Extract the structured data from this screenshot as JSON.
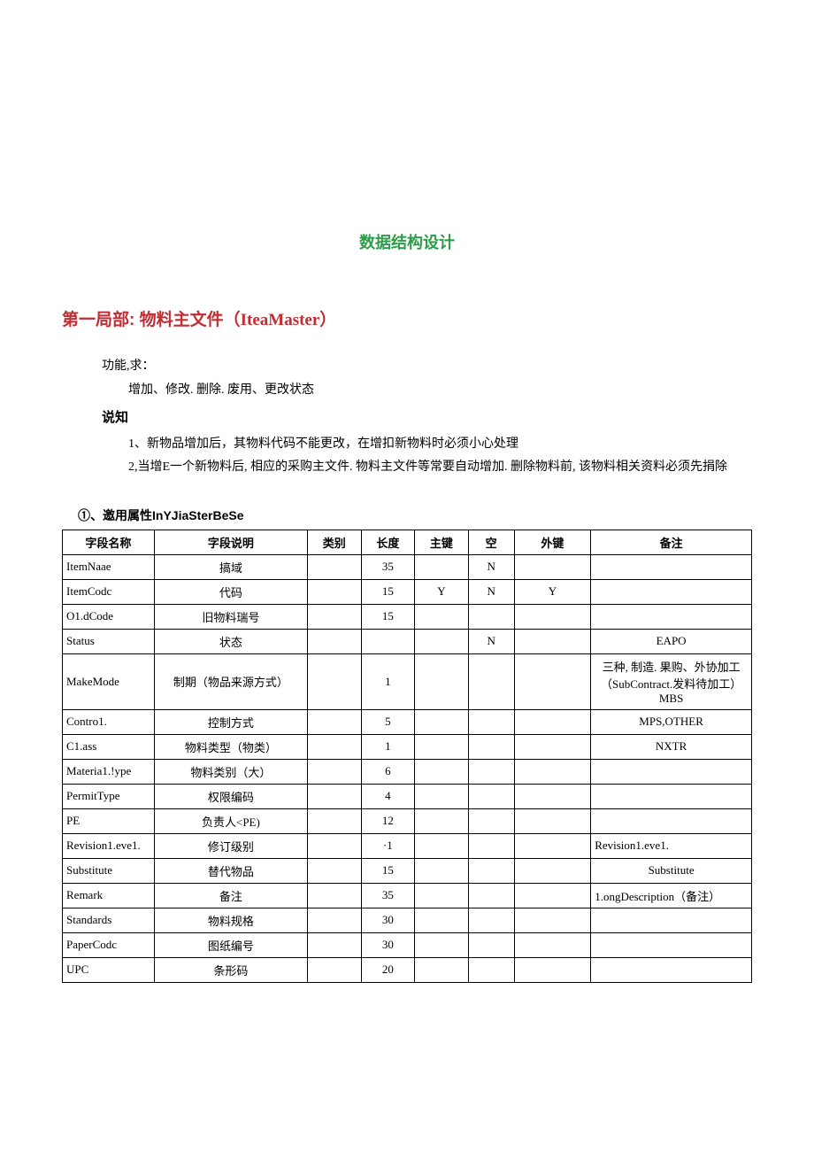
{
  "title": "数据结构设计",
  "section1": {
    "heading_prefix": "第一局部:",
    "heading_body": " 物料主文件（",
    "heading_eng": "IteaMaster",
    "heading_suffix": "）",
    "func_label": "功能,求：",
    "func_line": "增加、修改. 删除. 废用、更改状态",
    "note_label": "说知",
    "note1": "1、新物品增加后，其物料代码不能更改，在增扣新物料时必须小心处理",
    "note2": "2,当增E一个新物料后, 相应的采购主文件. 物料主文件等常要自动增加. 删除物料前, 该物料相关资料必须先捐除"
  },
  "table1_title": "①、邀用属性InYJiaSterBeSe",
  "table1": {
    "headers": [
      "字段名称",
      "字段说明",
      "类别",
      "长度",
      "主键",
      "空",
      "外键",
      "备注"
    ],
    "rows": [
      {
        "c1": "ItemNaae",
        "c2": "搞域",
        "c3": "",
        "c4": "35",
        "c5": "",
        "c6": "N",
        "c7": "",
        "c8": ""
      },
      {
        "c1": "ItemCodc",
        "c2": "代码",
        "c3": "",
        "c4": "15",
        "c5": "Y",
        "c6": "N",
        "c7": "Y",
        "c8": ""
      },
      {
        "c1": "O1.dCode",
        "c2": "旧物料瑞号",
        "c3": "",
        "c4": "15",
        "c5": "",
        "c6": "",
        "c7": "",
        "c8": ""
      },
      {
        "c1": "Status",
        "c2": "状态",
        "c3": "",
        "c4": "",
        "c5": "",
        "c6": "N",
        "c7": "",
        "c8": "EAPO"
      },
      {
        "c1": "MakeMode",
        "c2": "制期（物品来源方式）",
        "c3": "",
        "c4": "1",
        "c5": "",
        "c6": "",
        "c7": "",
        "c8": "三种, 制造. 果购、外协加工（SubContract.发料待加工）MBS"
      },
      {
        "c1": "Contro1.",
        "c2": "控制方式",
        "c3": "",
        "c4": "5",
        "c5": "",
        "c6": "",
        "c7": "",
        "c8": "MPS,OTHER"
      },
      {
        "c1": "C1.ass",
        "c2": "物料类型（物类）",
        "c3": "",
        "c4": "1",
        "c5": "",
        "c6": "",
        "c7": "",
        "c8": "NXTR"
      },
      {
        "c1": "Materia1.!ype",
        "c2": "物料类别（大）",
        "c3": "",
        "c4": "6",
        "c5": "",
        "c6": "",
        "c7": "",
        "c8": ""
      },
      {
        "c1": "PermitType",
        "c2": "权限编码",
        "c3": "",
        "c4": "4",
        "c5": "",
        "c6": "",
        "c7": "",
        "c8": ""
      },
      {
        "c1": "PE",
        "c2": "负责人<PE)",
        "c3": "",
        "c4": "12",
        "c5": "",
        "c6": "",
        "c7": "",
        "c8": ""
      },
      {
        "c1": "Revision1.eve1.",
        "c2": "修订级别",
        "c3": "",
        "c4": "·1",
        "c5": "",
        "c6": "",
        "c7": "",
        "c8": "Revision1.eve1."
      },
      {
        "c1": "Substitute",
        "c2": "替代物品",
        "c3": "",
        "c4": "15",
        "c5": "",
        "c6": "",
        "c7": "",
        "c8": "Substitute"
      },
      {
        "c1": "Remark",
        "c2": "备注",
        "c3": "",
        "c4": "35",
        "c5": "",
        "c6": "",
        "c7": "",
        "c8": "1.ongDescription（备注）"
      },
      {
        "c1": "Standards",
        "c2": "物料规格",
        "c3": "",
        "c4": "30",
        "c5": "",
        "c6": "",
        "c7": "",
        "c8": ""
      },
      {
        "c1": "PaperCodc",
        "c2": "图纸编号",
        "c3": "",
        "c4": "30",
        "c5": "",
        "c6": "",
        "c7": "",
        "c8": ""
      },
      {
        "c1": "UPC",
        "c2": "条形码",
        "c3": "",
        "c4": "20",
        "c5": "",
        "c6": "",
        "c7": "",
        "c8": ""
      }
    ]
  }
}
